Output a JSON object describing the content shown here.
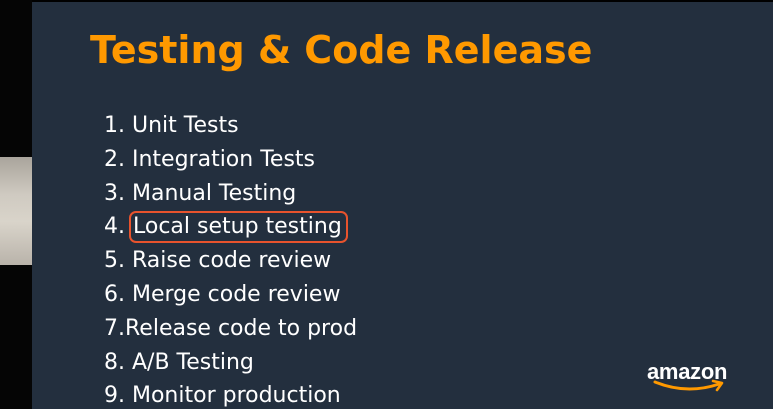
{
  "slide": {
    "title": "Testing & Code Release",
    "items": [
      {
        "number": "1. ",
        "text": "Unit Tests",
        "highlighted": false
      },
      {
        "number": "2. ",
        "text": "Integration Tests",
        "highlighted": false
      },
      {
        "number": "3. ",
        "text": "Manual Testing",
        "highlighted": false
      },
      {
        "number": "4. ",
        "text": "Local setup testing",
        "highlighted": true
      },
      {
        "number": "5. ",
        "text": "Raise code review",
        "highlighted": false
      },
      {
        "number": "6. ",
        "text": "Merge code review",
        "highlighted": false
      },
      {
        "number": "7.",
        "text": "Release code to prod",
        "highlighted": false
      },
      {
        "number": "8. ",
        "text": "A/B Testing",
        "highlighted": false
      },
      {
        "number": "9. ",
        "text": "Monitor production",
        "highlighted": false
      }
    ],
    "logo_text": "amazon",
    "colors": {
      "background": "#232f3e",
      "title": "#ff9900",
      "text": "#ffffff",
      "highlight_border": "#e8532d"
    }
  }
}
